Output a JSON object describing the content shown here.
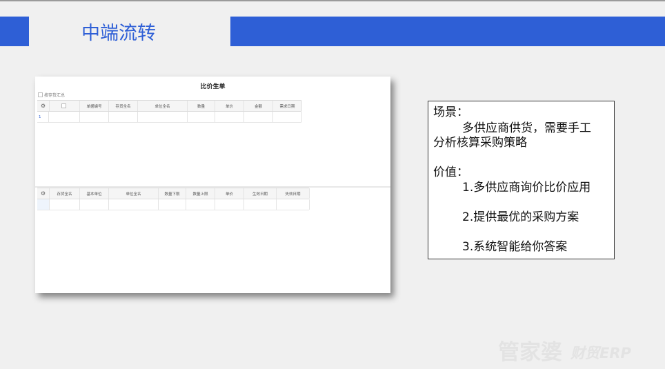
{
  "slide": {
    "title": "中端流转",
    "brand_main": "管家婆",
    "brand_sub": "财贸ERP",
    "accent_color": "#2e5fd6"
  },
  "window": {
    "title": "比价生单",
    "summary_checkbox_label": "按存货汇总",
    "upper_table": {
      "columns": [
        "单据编号",
        "存货全名",
        "单位全名",
        "数量",
        "单价",
        "金额",
        "需求日期"
      ],
      "row_numbers": [
        "1"
      ]
    },
    "lower_table": {
      "columns": [
        "存货全名",
        "基本单位",
        "单位全名",
        "数量下限",
        "数量上限",
        "单价",
        "生效日期",
        "失效日期"
      ]
    }
  },
  "scene_box": {
    "scene_label": "场景：",
    "scene_text_1": "多供应商供货，需要手工",
    "scene_text_2": "分析核算采购策略",
    "value_label": "价值：",
    "value_1": "1.多供应商询价比价应用",
    "value_2": "2.提供最优的采购方案",
    "value_3": "3.系统智能给你答案"
  }
}
